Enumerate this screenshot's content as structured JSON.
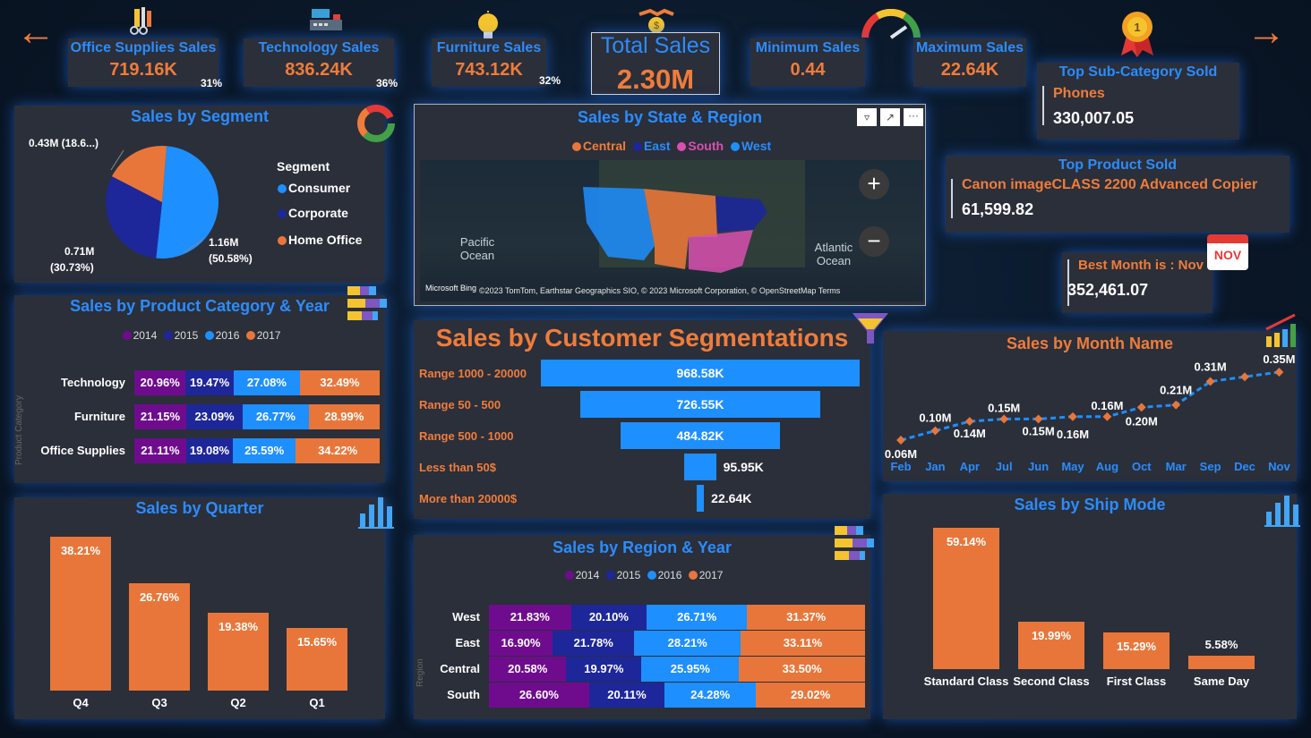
{
  "colors": {
    "orange": "#f07c3a",
    "blue": "#2b8cff",
    "purple": "#6f0c8e",
    "navy": "#1d2799",
    "card": "#2a2f3a"
  },
  "nav": {
    "prev_icon": "arrow-left-icon",
    "next_icon": "arrow-right-icon"
  },
  "kpis": {
    "office": {
      "title": "Office Supplies Sales",
      "value": "719.16K",
      "pct": "31%",
      "icon": "office-supplies-icon"
    },
    "tech": {
      "title": "Technology Sales",
      "value": "836.24K",
      "pct": "36%",
      "icon": "cash-register-icon"
    },
    "furniture": {
      "title": "Furniture Sales",
      "value": "743.12K",
      "pct": "32%",
      "icon": "lightbulb-icon"
    },
    "total": {
      "title": "Total Sales",
      "value": "2.30M",
      "icon": "handshake-money-icon"
    },
    "min": {
      "title": "Minimum Sales",
      "value": "0.44",
      "icon": "gauge-icon"
    },
    "max": {
      "title": "Maximum Sales",
      "value": "22.64K",
      "icon": "medal-icon",
      "medal_text": "1"
    }
  },
  "top_subcat": {
    "title": "Top Sub-Category Sold",
    "name": "Phones",
    "value": "330,007.05"
  },
  "top_product": {
    "title": "Top Product Sold",
    "name": "Canon imageCLASS 2200 Advanced Copier",
    "value": "61,599.82"
  },
  "best_month": {
    "title": "Best Month is : Nov",
    "value": "352,461.07",
    "badge": "NOV"
  },
  "segment": {
    "title": "Sales by Segment",
    "legend_title": "Segment",
    "legend": [
      "Consumer",
      "Corporate",
      "Home Office"
    ],
    "labels": {
      "home": "0.43M (18.6...)",
      "corp_a": "0.71M",
      "corp_b": "(30.73%)",
      "cons_a": "1.16M",
      "cons_b": "(50.58%)"
    }
  },
  "map": {
    "title": "Sales by State & Region",
    "legend": [
      "Central",
      "East",
      "South",
      "West"
    ],
    "pacific": "Pacific Ocean",
    "atlantic": "Atlantic Ocean",
    "attribution": "©2023 TomTom, Earthstar Geographics SIO, © 2023 Microsoft Corporation, © OpenStreetMap Terms",
    "bing": "Microsoft Bing",
    "zoom_in": "+",
    "zoom_out": "−",
    "more": "···"
  },
  "cat_year": {
    "title": "Sales by Product Category & Year",
    "legend": [
      "2014",
      "2015",
      "2016",
      "2017"
    ],
    "axis": "Product Category",
    "rows": [
      {
        "label": "Technology",
        "v": [
          "20.96%",
          "19.47%",
          "27.08%",
          "32.49%"
        ]
      },
      {
        "label": "Furniture",
        "v": [
          "21.15%",
          "23.09%",
          "26.77%",
          "28.99%"
        ]
      },
      {
        "label": "Office Supplies",
        "v": [
          "21.11%",
          "19.08%",
          "25.59%",
          "34.22%"
        ]
      }
    ]
  },
  "cust_seg": {
    "title": "Sales by Customer Segmentations",
    "rows": [
      {
        "label": "Range 1000 - 20000",
        "value": "968.58K"
      },
      {
        "label": "Range 50 - 500",
        "value": "726.55K"
      },
      {
        "label": "Range 500 - 1000",
        "value": "484.82K"
      },
      {
        "label": "Less than 50$",
        "value": "95.95K"
      },
      {
        "label": "More than 20000$",
        "value": "22.64K"
      }
    ]
  },
  "region_year": {
    "title": "Sales by Region & Year",
    "legend": [
      "2014",
      "2015",
      "2016",
      "2017"
    ],
    "axis": "Region",
    "rows": [
      {
        "label": "West",
        "v": [
          "21.83%",
          "20.10%",
          "26.71%",
          "31.37%"
        ]
      },
      {
        "label": "East",
        "v": [
          "16.90%",
          "21.78%",
          "28.21%",
          "33.11%"
        ]
      },
      {
        "label": "Central",
        "v": [
          "20.58%",
          "19.97%",
          "25.95%",
          "33.50%"
        ]
      },
      {
        "label": "South",
        "v": [
          "26.60%",
          "20.11%",
          "24.28%",
          "29.02%"
        ]
      }
    ]
  },
  "quarter": {
    "title": "Sales by Quarter",
    "icon": "bar-chart-icon"
  },
  "month": {
    "title": "Sales by Month Name",
    "icon": "growth-chart-icon"
  },
  "ship": {
    "title": "Sales by Ship Mode",
    "icon": "bar-chart-icon"
  },
  "chart_data": [
    {
      "type": "pie",
      "title": "Sales by Segment",
      "categories": [
        "Consumer",
        "Corporate",
        "Home Office"
      ],
      "values": [
        1.16,
        0.71,
        0.43
      ],
      "percent": [
        50.58,
        30.73,
        18.69
      ],
      "colors": [
        "#1e8fff",
        "#1d2799",
        "#e8763a"
      ]
    },
    {
      "type": "bar",
      "title": "Sales by Customer Segmentations",
      "categories": [
        "Range 1000 - 20000",
        "Range 50 - 500",
        "Range 500 - 1000",
        "Less than 50$",
        "More than 20000$"
      ],
      "values": [
        968.58,
        726.55,
        484.82,
        95.95,
        22.64
      ]
    },
    {
      "type": "bar",
      "title": "Sales by Quarter",
      "categories": [
        "Q4",
        "Q3",
        "Q2",
        "Q1"
      ],
      "values": [
        38.21,
        26.76,
        19.38,
        15.65
      ],
      "labels": [
        "38.21%",
        "26.76%",
        "19.38%",
        "15.65%"
      ]
    },
    {
      "type": "line",
      "title": "Sales by Month Name",
      "categories": [
        "Feb",
        "Jan",
        "Apr",
        "Jul",
        "Jun",
        "May",
        "Aug",
        "Oct",
        "Mar",
        "Sep",
        "Dec",
        "Nov"
      ],
      "values": [
        0.06,
        0.1,
        0.14,
        0.15,
        0.15,
        0.16,
        0.16,
        0.2,
        0.21,
        0.31,
        0.33,
        0.35
      ],
      "labels": [
        "0.06M",
        "0.10M",
        "0.14M",
        "0.15M",
        "0.15M",
        "0.16M",
        "0.16M",
        "0.20M",
        "0.21M",
        "0.31M",
        "",
        "0.35M"
      ]
    },
    {
      "type": "bar",
      "title": "Sales by Ship Mode",
      "categories": [
        "Standard Class",
        "Second Class",
        "First Class",
        "Same Day"
      ],
      "values": [
        59.14,
        19.99,
        15.29,
        5.58
      ],
      "labels": [
        "59.14%",
        "19.99%",
        "15.29%",
        "5.58%"
      ]
    }
  ]
}
